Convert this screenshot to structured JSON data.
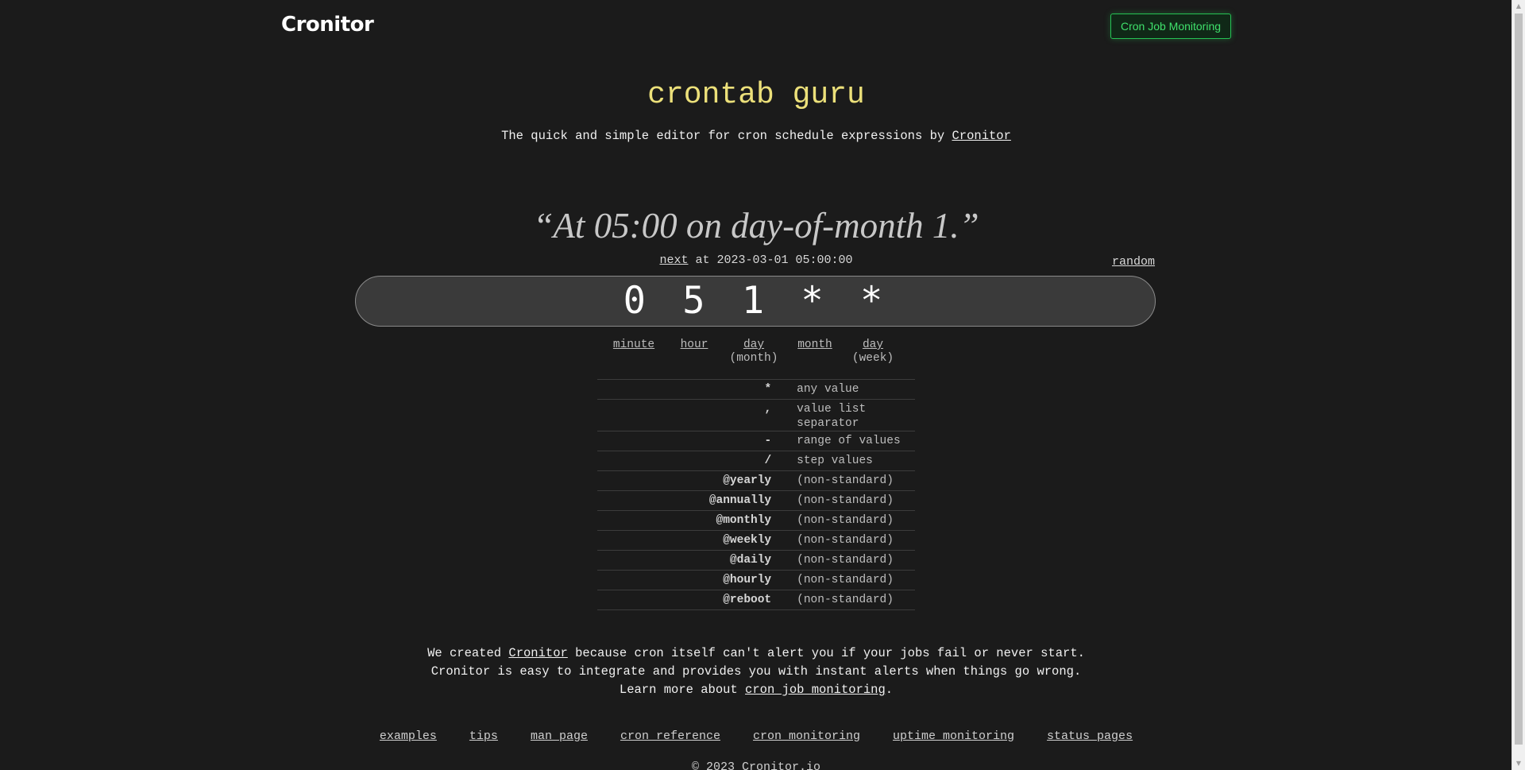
{
  "header": {
    "logo_text": "Cronitor",
    "cta_label": "Cron Job Monitoring"
  },
  "hero": {
    "title": "crontab guru",
    "subtitle_prefix": "The quick and simple editor for cron schedule expressions by ",
    "subtitle_link": "Cronitor"
  },
  "schedule": {
    "description": "“At 05:00 on day-of-month 1.”",
    "next_label": "next",
    "next_text": " at 2023-03-01 05:00:00",
    "random_label": "random",
    "expression": "0 5 1 * *"
  },
  "fields": [
    {
      "label": "minute",
      "sub": ""
    },
    {
      "label": "hour",
      "sub": ""
    },
    {
      "label": "day",
      "sub": "(month)"
    },
    {
      "label": "month",
      "sub": ""
    },
    {
      "label": "day",
      "sub": "(week)"
    }
  ],
  "legend": [
    {
      "symbol": "*",
      "desc": "any value"
    },
    {
      "symbol": ",",
      "desc": "value list separator"
    },
    {
      "symbol": "-",
      "desc": "range of values"
    },
    {
      "symbol": "/",
      "desc": "step values"
    },
    {
      "symbol": "@yearly",
      "desc": "(non-standard)"
    },
    {
      "symbol": "@annually",
      "desc": "(non-standard)"
    },
    {
      "symbol": "@monthly",
      "desc": "(non-standard)"
    },
    {
      "symbol": "@weekly",
      "desc": "(non-standard)"
    },
    {
      "symbol": "@daily",
      "desc": "(non-standard)"
    },
    {
      "symbol": "@hourly",
      "desc": "(non-standard)"
    },
    {
      "symbol": "@reboot",
      "desc": "(non-standard)"
    }
  ],
  "promo": {
    "line1_prefix": "We created ",
    "line1_link": "Cronitor",
    "line1_suffix": " because cron itself can't alert you if your jobs fail or never start.",
    "line2": "Cronitor is easy to integrate and provides you with instant alerts when things go wrong.",
    "line3_prefix": "Learn more about ",
    "line3_link": "cron job monitoring",
    "line3_suffix": "."
  },
  "footer": {
    "links": [
      "examples",
      "tips",
      "man page",
      "cron reference",
      "cron monitoring",
      "uptime monitoring",
      "status pages"
    ],
    "copyright": "© 2023 Cronitor.io"
  },
  "colors": {
    "background": "#1b1b1b",
    "title": "#ece07a",
    "accent_green": "#26c254"
  }
}
